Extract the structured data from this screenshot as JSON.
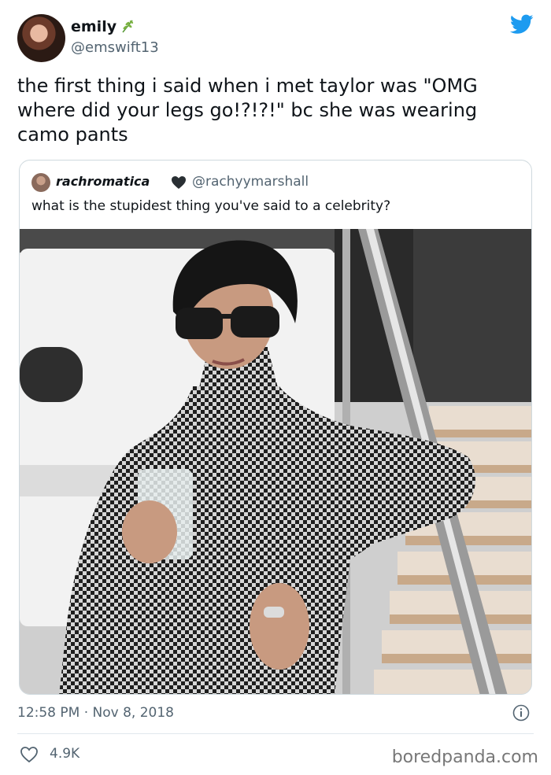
{
  "author": {
    "name": "emily",
    "handle": "@emswift13",
    "name_badge": "sprig-icon",
    "avatar": "avatar"
  },
  "tweet": {
    "text": "the first thing i said when i met taylor was \"OMG where did your legs go!?!?!\" bc she was wearing camo pants"
  },
  "quoted_tweet": {
    "author_name": "rachromatica",
    "author_handle": "@rachyymarshall",
    "badge": "heart-icon",
    "text": "what is the stupidest thing you've said to a celebrity?",
    "media": "photo"
  },
  "footer": {
    "timestamp": "12:58 PM · Nov 8, 2018",
    "likes": "4.9K"
  },
  "watermark": "boredpanda.com",
  "colors": {
    "twitter_blue": "#1d9bf0",
    "secondary_text": "#536471",
    "border": "#cfd9de"
  }
}
